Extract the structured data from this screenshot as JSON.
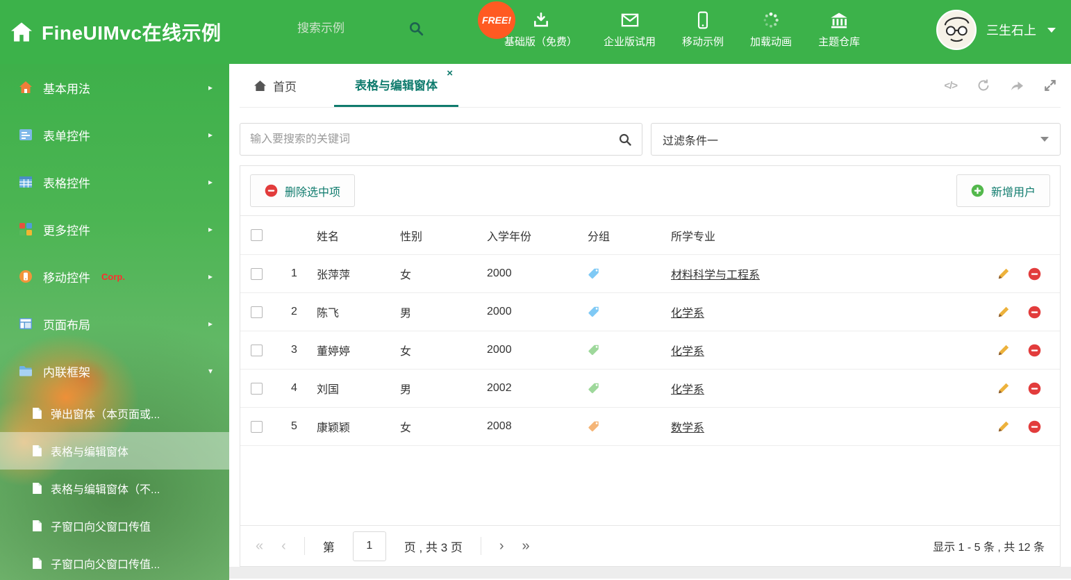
{
  "colors": {
    "header-green": "#3cb24a",
    "accent-teal": "#0f7b6d",
    "danger-red": "#e23c3c",
    "success-green": "#53b84c",
    "free-badge": "#ff5a22"
  },
  "header": {
    "title": "FineUIMvc在线示例",
    "search_placeholder": "搜索示例",
    "free_badge": "FREE!",
    "nav": [
      {
        "label": "基础版（免费）",
        "icon": "download-icon"
      },
      {
        "label": "企业版试用",
        "icon": "envelope-icon"
      },
      {
        "label": "移动示例",
        "icon": "mobile-icon"
      },
      {
        "label": "加载动画",
        "icon": "loading-dots-icon"
      },
      {
        "label": "主题仓库",
        "icon": "bank-icon"
      }
    ],
    "user": {
      "name": "三生石上"
    }
  },
  "sidebar": {
    "items": [
      {
        "label": "基本用法",
        "icon": "home-icon"
      },
      {
        "label": "表单控件",
        "icon": "form-icon"
      },
      {
        "label": "表格控件",
        "icon": "table-icon"
      },
      {
        "label": "更多控件",
        "icon": "blocks-icon"
      },
      {
        "label": "移动控件",
        "badge": "Corp.",
        "icon": "mobile-orange-icon"
      },
      {
        "label": "页面布局",
        "icon": "layout-icon"
      },
      {
        "label": "内联框架",
        "icon": "folder-icon"
      }
    ],
    "subitems": [
      {
        "label": "弹出窗体（本页面或..."
      },
      {
        "label": "表格与编辑窗体",
        "active": true
      },
      {
        "label": "表格与编辑窗体（不..."
      },
      {
        "label": "子窗口向父窗口传值"
      },
      {
        "label": "子窗口向父窗口传值..."
      }
    ]
  },
  "tabs": {
    "home_label": "首页",
    "active_label": "表格与编辑窗体"
  },
  "filter": {
    "search_placeholder": "输入要搜索的关键词",
    "dropdown_value": "过滤条件一"
  },
  "toolbar": {
    "delete_label": "删除选中项",
    "add_label": "新增用户"
  },
  "table": {
    "headers": [
      "姓名",
      "性别",
      "入学年份",
      "分组",
      "所学专业"
    ],
    "rows": [
      {
        "num": "1",
        "name": "张萍萍",
        "gender": "女",
        "year": "2000",
        "tag_color": "#7fc9f5",
        "major": "材料科学与工程系"
      },
      {
        "num": "2",
        "name": "陈飞",
        "gender": "男",
        "year": "2000",
        "tag_color": "#7fc9f5",
        "major": "化学系"
      },
      {
        "num": "3",
        "name": "董婷婷",
        "gender": "女",
        "year": "2000",
        "tag_color": "#9ed89b",
        "major": "化学系"
      },
      {
        "num": "4",
        "name": "刘国",
        "gender": "男",
        "year": "2002",
        "tag_color": "#9ed89b",
        "major": "化学系"
      },
      {
        "num": "5",
        "name": "康颖颖",
        "gender": "女",
        "year": "2008",
        "tag_color": "#f5b577",
        "major": "数学系"
      }
    ]
  },
  "pager": {
    "page_label_prefix": "第",
    "page": "1",
    "page_label_suffix": "页 , 共 3 页",
    "summary": "显示 1 - 5 条 , 共 12 条"
  }
}
